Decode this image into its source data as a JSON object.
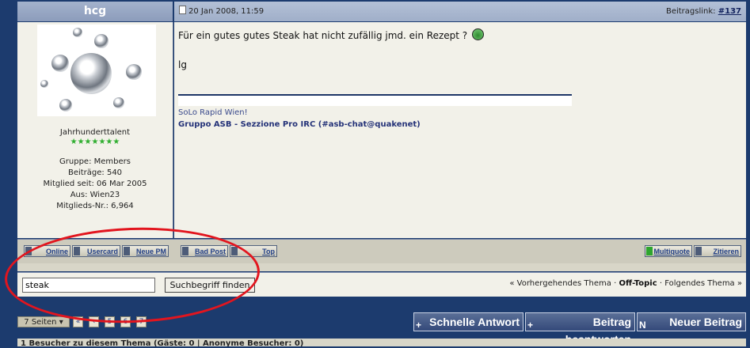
{
  "post": {
    "author": "hcg",
    "date": "20 Jan 2008, 11:59",
    "link_label": "Beitragslink:",
    "link_number": "#137",
    "body_line1": "Für ein gutes gutes Steak hat nicht zufällig jmd. ein Rezept ?",
    "body_line2": "lg",
    "signature_line1": "SoLo Rapid Wien!",
    "signature_line2": "Gruppo ASB - Sezzione Pro IRC (#asb-chat@quakenet)"
  },
  "author_info": {
    "rank": "Jahrhunderttalent",
    "stars": "★★★★★★★",
    "group": "Gruppe: Members",
    "posts": "Beiträge: 540",
    "member_since": "Mitglied seit: 06 Mar 2005",
    "from": "Aus: Wien23",
    "member_no": "Mitglieds-Nr.: 6,964"
  },
  "post_buttons": {
    "online": "Online",
    "usercard": "Usercard",
    "new_pm": "Neue PM",
    "bad_post": "Bad Post",
    "top": "Top",
    "multiquote": "Multiquote",
    "quote": "Zitieren"
  },
  "search": {
    "value": "steak",
    "button": "Suchbegriff finden"
  },
  "topic_nav": {
    "prev": "« Vorhergehendes Thema",
    "sep1": "·",
    "forum": "Off-Topic",
    "sep2": "·",
    "next": "Folgendes Thema »"
  },
  "pagination": {
    "label": "7 Seiten ▾",
    "pages": [
      "«",
      "‹",
      "5",
      "6",
      "7"
    ]
  },
  "actions": {
    "quick_reply": "Schnelle Antwort",
    "reply": "Beitrag beantworten",
    "new_post": "Neuer Beitrag",
    "quick_glyph": "+",
    "reply_glyph": "+",
    "new_glyph": "N"
  },
  "footer": {
    "visitors": "1 Besucher zu diesem Thema (Gäste: 0 | Anonyme Besucher: 0)"
  },
  "colors": {
    "background": "#1c3b6e",
    "annotation": "#e2151e",
    "stars": "#2fae2f"
  }
}
